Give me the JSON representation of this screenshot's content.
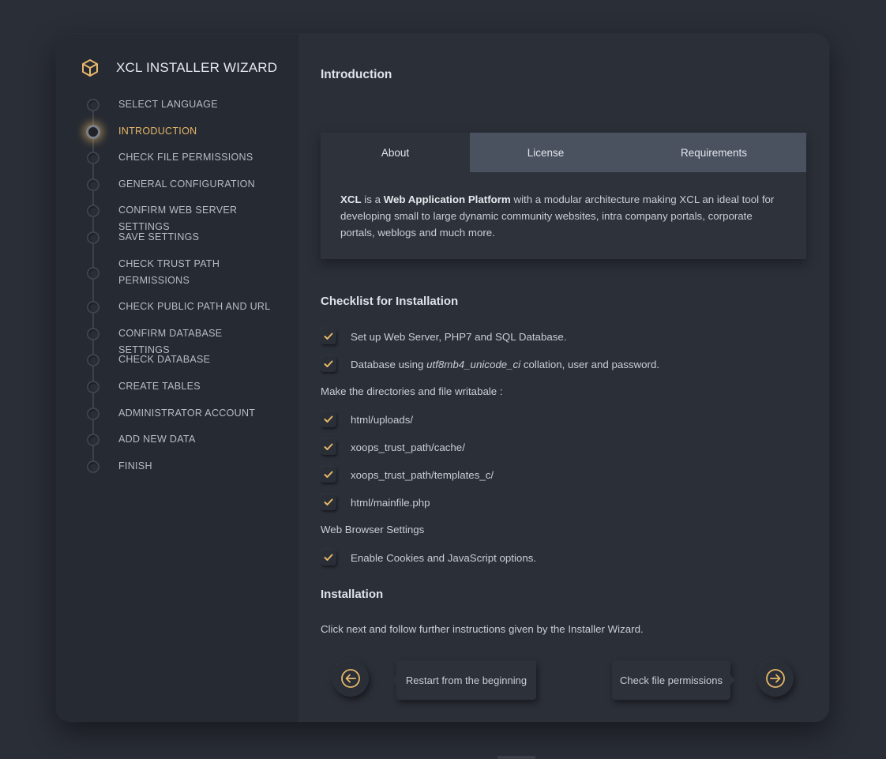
{
  "app": {
    "title": "XCL INSTALLER WIZARD",
    "accent_color": "#e8b86a"
  },
  "sidebar": {
    "steps": [
      {
        "label": "SELECT LANGUAGE",
        "state": "done"
      },
      {
        "label": "INTRODUCTION",
        "state": "active"
      },
      {
        "label": "CHECK FILE PERMISSIONS",
        "state": "pending"
      },
      {
        "label": "GENERAL CONFIGURATION",
        "state": "pending"
      },
      {
        "label": "CONFIRM WEB SERVER SETTINGS",
        "state": "pending"
      },
      {
        "label": "SAVE SETTINGS",
        "state": "pending"
      },
      {
        "label": "CHECK TRUST PATH PERMISSIONS",
        "state": "pending"
      },
      {
        "label": "CHECK PUBLIC PATH AND URL",
        "state": "pending"
      },
      {
        "label": "CONFIRM DATABASE SETTINGS",
        "state": "pending"
      },
      {
        "label": "CHECK DATABASE",
        "state": "pending"
      },
      {
        "label": "CREATE TABLES",
        "state": "pending"
      },
      {
        "label": "ADMINISTRATOR ACCOUNT",
        "state": "pending"
      },
      {
        "label": "ADD NEW DATA",
        "state": "pending"
      },
      {
        "label": "FINISH",
        "state": "pending"
      }
    ]
  },
  "main": {
    "title": "Introduction",
    "tabs": [
      {
        "label": "About",
        "active": true
      },
      {
        "label": "License",
        "active": false
      },
      {
        "label": "Requirements",
        "active": false
      }
    ],
    "about": {
      "brand": "XCL",
      "t1": " is a ",
      "emphasis": "Web Application Platform",
      "t2": " with a modular architecture making XCL an ideal tool for developing small to large dynamic community websites, intra company portals, corporate portals, weblogs and much more."
    },
    "checklist": {
      "title": "Checklist for Installation",
      "item_server": "Set up Web Server, PHP7 and SQL Database.",
      "db_prefix": "Database using ",
      "db_collation": "utf8mb4_unicode_ci",
      "db_suffix": " collation, user and password.",
      "dirs_label": "Make the directories and file writabale :",
      "dirs": [
        "html/uploads/",
        "xoops_trust_path/cache/",
        "xoops_trust_path/templates_c/",
        "html/mainfile.php"
      ],
      "browser_label": "Web Browser Settings",
      "browser_item": "Enable Cookies and JavaScript options."
    },
    "installation": {
      "title": "Installation",
      "text": "Click next and follow further instructions given by the Installer Wizard."
    },
    "nav": {
      "back_label": "Restart from the beginning",
      "next_label": "Check file permissions",
      "back_icon": "arrow-left-circle-icon",
      "next_icon": "arrow-right-circle-icon"
    }
  }
}
